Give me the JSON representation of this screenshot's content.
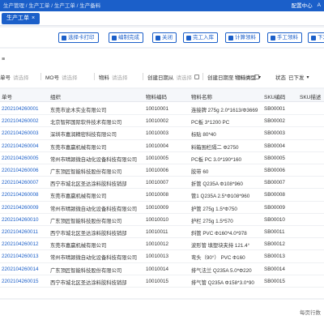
{
  "topbar": {
    "breadcrumb": "生产管理 / 生产工单 / 生产工单 / 生产备料",
    "notice": "配置中心",
    "user": "A"
  },
  "tab": {
    "label": "生产工单",
    "close": "×"
  },
  "toolbar": {
    "buttons": [
      "选择卡打印",
      "编制完成",
      "关闭",
      "完工入库",
      "计算领料",
      "手工领料",
      "下发"
    ]
  },
  "filters": {
    "collapse_icon": "≡",
    "items": [
      {
        "label": "单号",
        "placeholder": "请选择"
      },
      {
        "label": "MO号",
        "placeholder": "请选择"
      },
      {
        "label": "物料",
        "placeholder": "请选择"
      },
      {
        "label": "创建日期从",
        "placeholder": "请选择"
      },
      {
        "label": "创建日期至",
        "placeholder": "请选择"
      },
      {
        "label": "物料类型",
        "placeholder": ""
      },
      {
        "label": "状态",
        "placeholder": "已下发"
      }
    ]
  },
  "table": {
    "columns": [
      "单号",
      "组织",
      "物料编码",
      "物料名称",
      "SKU编码",
      "SKU描述"
    ],
    "rows": [
      [
        "2202104260001",
        "东莞市途木实业有限公司",
        "10010001",
        "连接牌 275g 2.0*1613/Φ3669",
        "SB00001",
        ""
      ],
      [
        "2202104260002",
        "北京智邦国际软件技术有限公司",
        "10010002",
        "PC板 3*1200 PC",
        "SB00002",
        ""
      ],
      [
        "2202104260003",
        "深圳市嘉润精密科技有限公司",
        "10010003",
        "标贴 80*40",
        "SB00003",
        ""
      ],
      [
        "2202104260004",
        "东莞市嘉赢机械有限公司",
        "10010004",
        "料箱围栏隔二 Φ2750",
        "SB00004",
        ""
      ],
      [
        "2202104260005",
        "常州市晴颍微自动化设备科技有限公司",
        "10010005",
        "PC板 PC 3.0*190*160",
        "SB00005",
        ""
      ],
      [
        "2202104260006",
        "广东顶匠智能科技股份有限公司",
        "10010006",
        "胶带 60",
        "SB00006",
        ""
      ],
      [
        "2202104260007",
        "西宁市城北区圣达涂料胶科技销部",
        "10010007",
        "折管 Q235A Φ108*960",
        "SB00007",
        ""
      ],
      [
        "2202104260008",
        "东莞市嘉赢机械有限公司",
        "10010008",
        "管1 Q235A 2.5*Φ108*960",
        "SB00008",
        ""
      ],
      [
        "2202104260009",
        "常州市晴颍微自动化设备科技有限公司",
        "10010009",
        "护管 275g 1.5*Φ750",
        "SB00009",
        ""
      ],
      [
        "2202104260010",
        "广东顶匠智能科技股份有限公司",
        "10010010",
        "护栏 275g 1.5*570",
        "SB00010",
        ""
      ],
      [
        "2202104260011",
        "西宁市城北区圣达涂料胶科技销部",
        "10010011",
        "斜管 PVC Φ160*4.0*978",
        "SB00011",
        ""
      ],
      [
        "2202104260012",
        "东莞市嘉赢机械有限公司",
        "10010012",
        "波形管 填塑块夹持 121.4°",
        "SB00012",
        ""
      ],
      [
        "2202104260013",
        "常州市晴颍微自动化设备科技有限公司",
        "10010013",
        "弯头（90°） PVC Φ160",
        "SB00013",
        ""
      ],
      [
        "2202104260014",
        "广东顶匠智能科技股份有限公司",
        "10010014",
        "排气法兰 Q235A 5.0*Φ220",
        "SB00014",
        ""
      ],
      [
        "2202104260015",
        "西宁市城北区圣达涂料胶科技销部",
        "10010015",
        "排气管 Q235A Φ158*3.0*90",
        "SB00015",
        ""
      ]
    ]
  },
  "footer": {
    "pagination": "每页行数"
  }
}
